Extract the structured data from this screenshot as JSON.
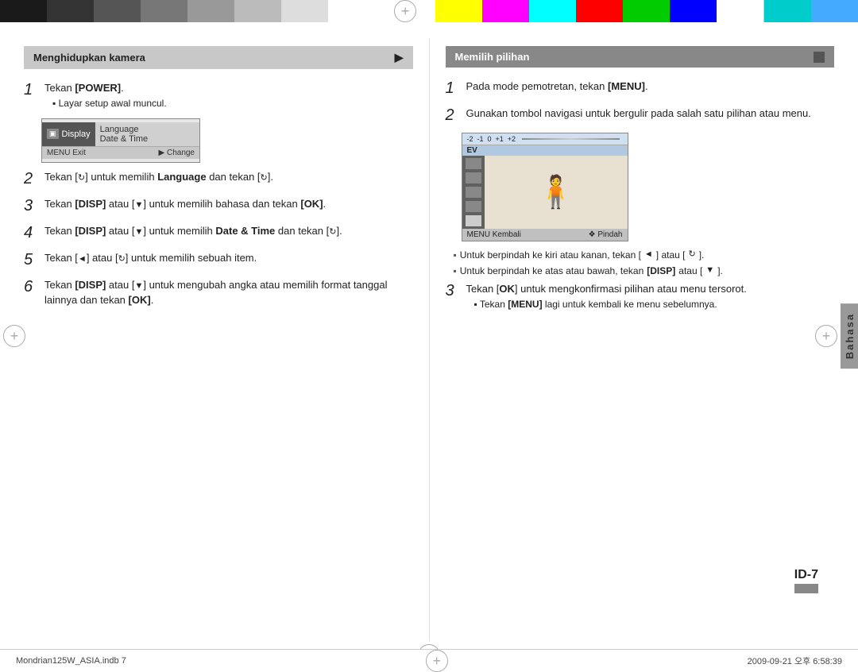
{
  "colors": {
    "swatches_left": [
      "#1a1a1a",
      "#333",
      "#666",
      "#999",
      "#ccc",
      "#fff",
      "#ffe0e0"
    ],
    "swatches_right": [
      "#ffff00",
      "#ff00ff",
      "#00ffff",
      "#ff0000",
      "#00ff00",
      "#0000ff",
      "#ffffff",
      "#00cccc",
      "#00aaff"
    ]
  },
  "left_section": {
    "title": "Menghidupkan kamera",
    "step1": {
      "num": "1",
      "text": "Tekan [POWER].",
      "sub": "Layar setup awal muncul."
    },
    "screen": {
      "left_label": "Display",
      "right_line1": "Language",
      "right_line2": "Date & Time",
      "footer_left": "MENU Exit",
      "footer_right": "▶  Change"
    },
    "step2": {
      "num": "2",
      "text_pre": "Tekan [",
      "text_icon": "↻",
      "text_mid": "] untuk memilih ",
      "text_bold": "Language",
      "text_post": " dan tekan [",
      "text_icon2": "↻",
      "text_end": "]."
    },
    "step3": {
      "num": "3",
      "text": "Tekan [DISP] atau [▼] untuk memilih bahasa dan tekan [OK]."
    },
    "step4": {
      "num": "4",
      "text_pre": "Tekan [DISP] atau [▼] untuk memilih ",
      "text_bold": "Date & Time",
      "text_post": " dan tekan [↻]."
    },
    "step5": {
      "num": "5",
      "text": "Tekan [◄] atau [↻] untuk memilih sebuah item."
    },
    "step6": {
      "num": "6",
      "text_pre": "Tekan [DISP] atau [▼] untuk mengubah angka atau memilih format tanggal lainnya dan tekan [",
      "text_bold": "OK",
      "text_post": "]."
    }
  },
  "right_section": {
    "title": "Memilih pilihan",
    "step1": {
      "num": "1",
      "text": "Pada mode pemotretan, tekan [MENU]."
    },
    "step2": {
      "num": "2",
      "text": "Gunakan tombol navigasi untuk bergulir pada salah satu pilihan atau menu."
    },
    "screen": {
      "ev_label": "EV",
      "scale": "-2  -1  0  +1  +2",
      "footer_left": "MENU Kembali",
      "footer_right": "❖  Pindah"
    },
    "bullet1": "Untuk berpindah ke kiri atau kanan, tekan [◄] atau [↻].",
    "bullet2": "Untuk berpindah ke atas atau bawah, tekan [DISP] atau [▼].",
    "step3": {
      "num": "3",
      "text_pre": "Tekan [",
      "text_bold": "OK",
      "text_post": "] untuk mengkonfirmasi pilihan atau menu tersorot."
    },
    "sub_bullet": "Tekan [MENU] lagi untuk kembali ke menu sebelumnya."
  },
  "side_tab": "Bahasa",
  "page_number": "ID-7",
  "footer": {
    "left": "Mondrian125W_ASIA.indb   7",
    "right": "2009-09-21   오후 6:58:39"
  }
}
